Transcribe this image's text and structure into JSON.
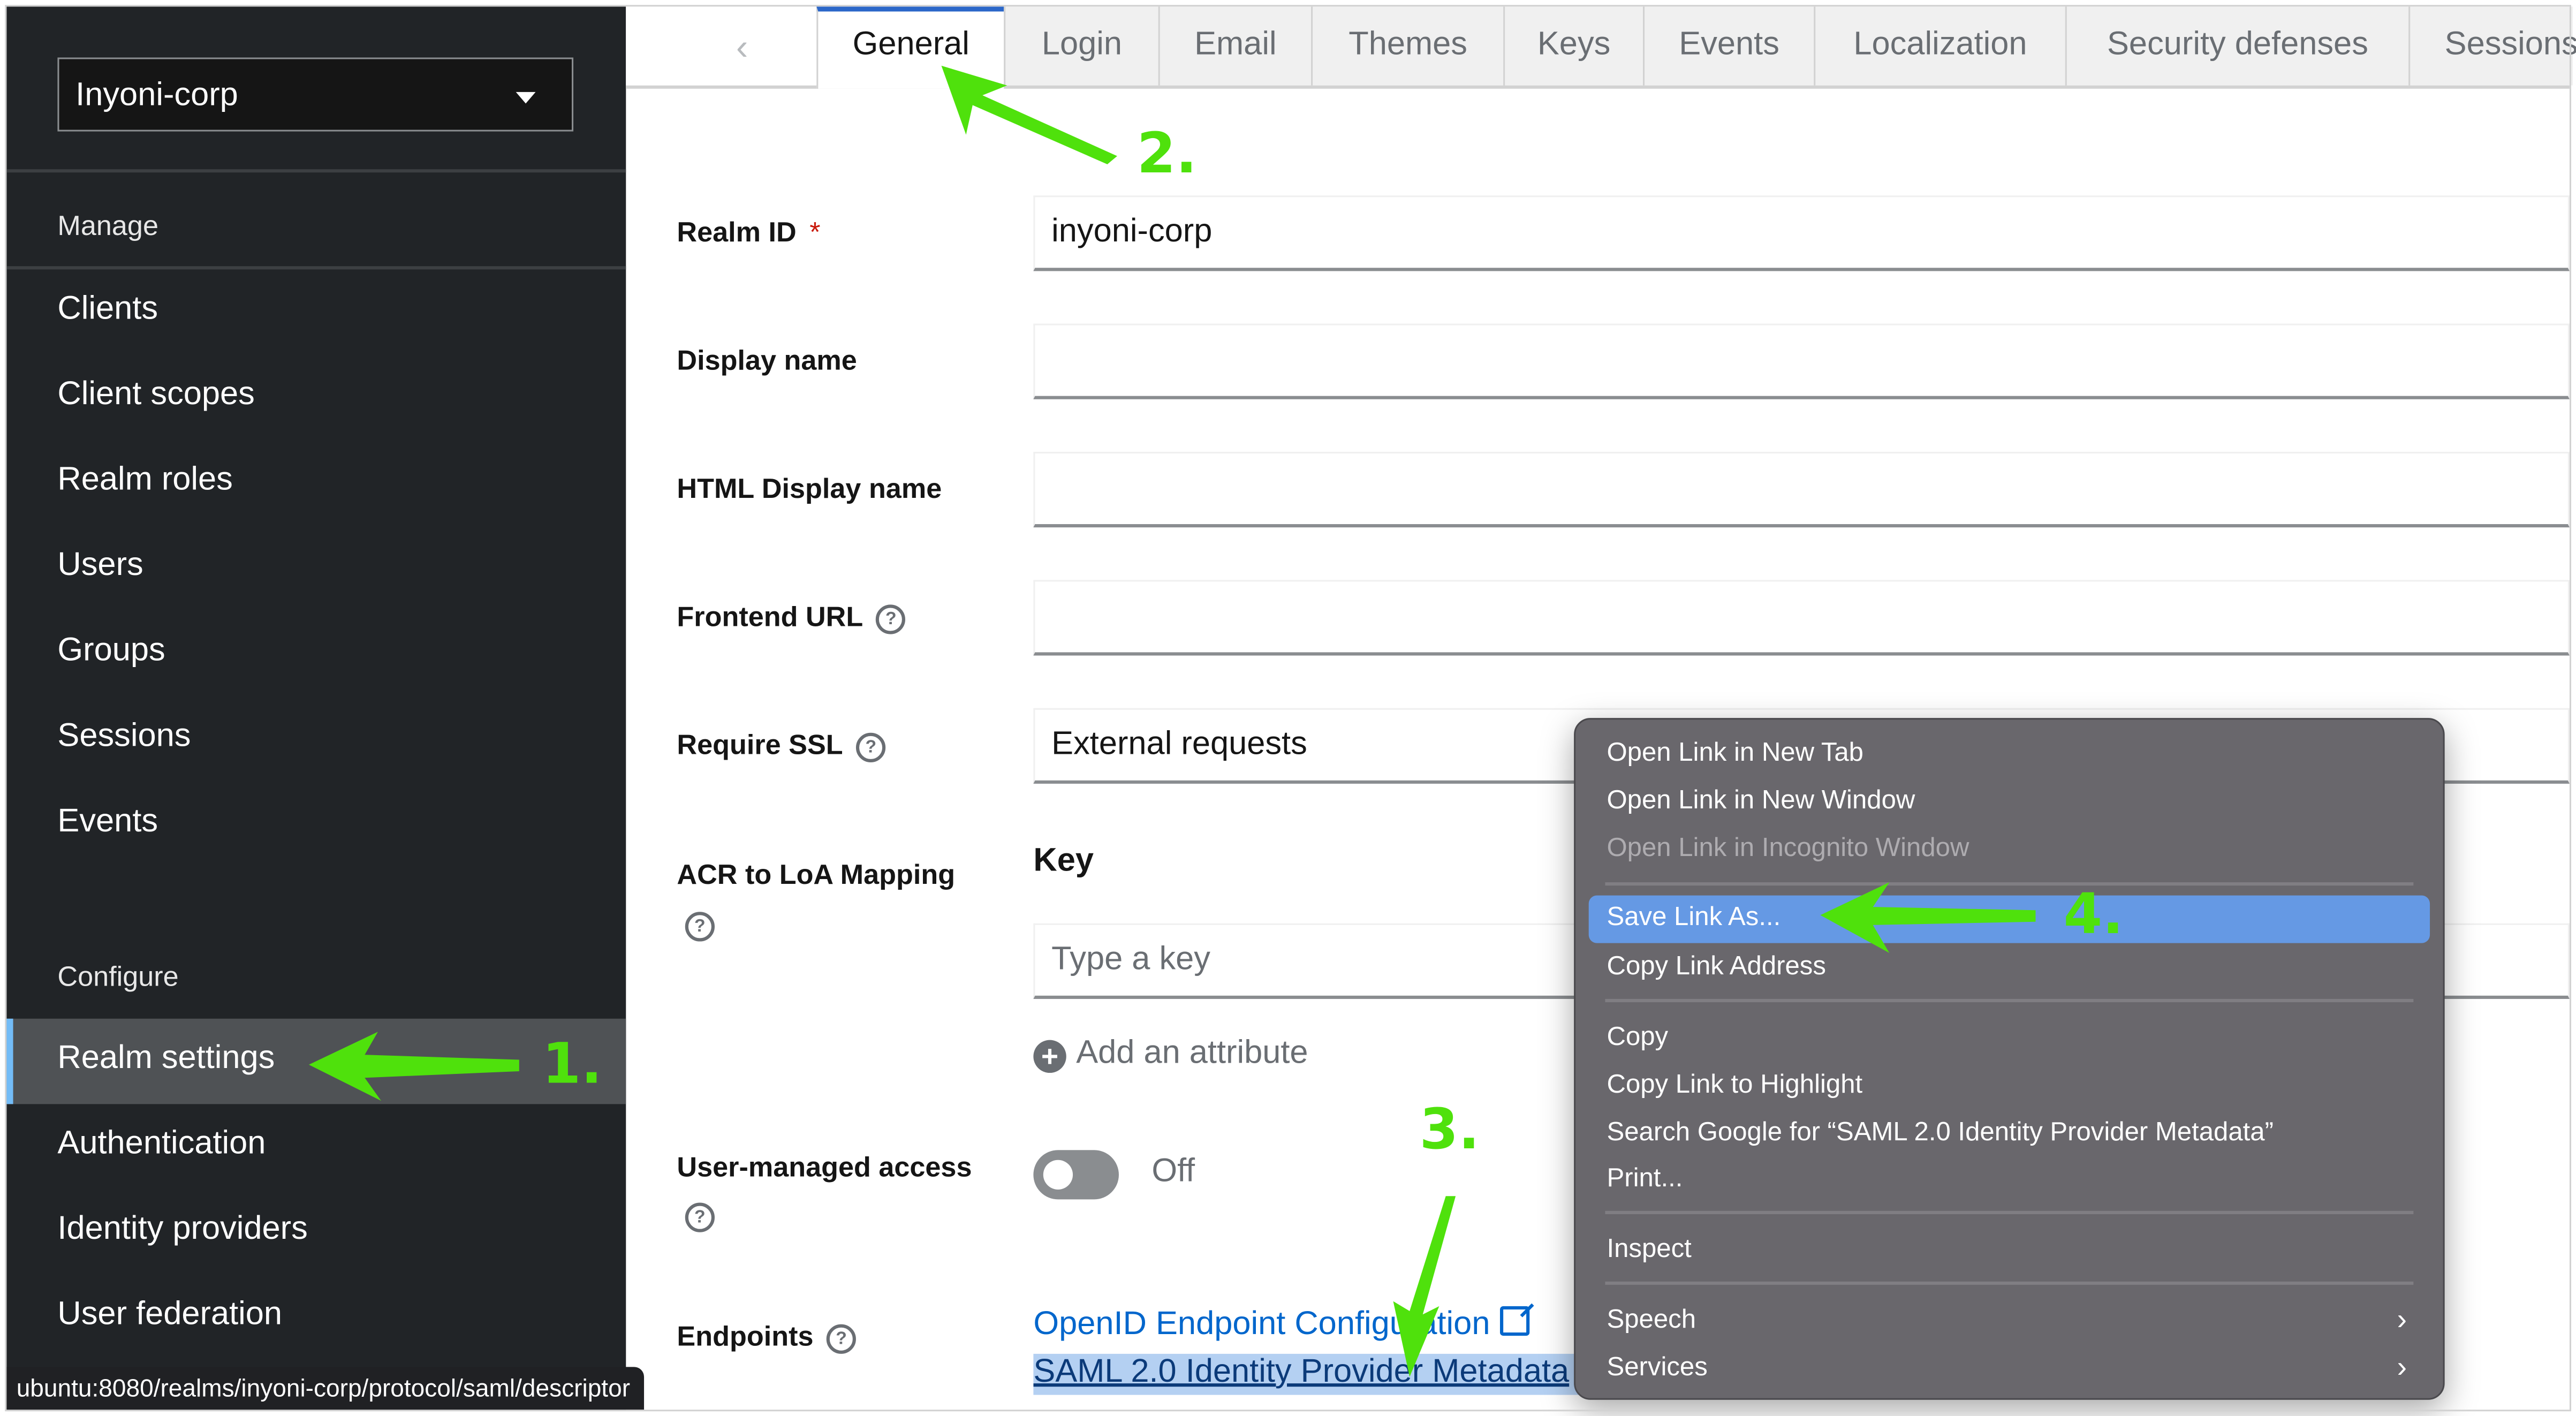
{
  "sidebar": {
    "realm_selector": {
      "value": "Inyoni-corp"
    },
    "sections": {
      "manage": "Manage",
      "configure": "Configure"
    },
    "manage_items": [
      {
        "label": "Clients"
      },
      {
        "label": "Client scopes"
      },
      {
        "label": "Realm roles"
      },
      {
        "label": "Users"
      },
      {
        "label": "Groups"
      },
      {
        "label": "Sessions"
      },
      {
        "label": "Events"
      }
    ],
    "configure_items": [
      {
        "label": "Realm settings",
        "active": true
      },
      {
        "label": "Authentication"
      },
      {
        "label": "Identity providers"
      },
      {
        "label": "User federation"
      }
    ]
  },
  "tabs": {
    "scroll_left_icon": "chevron-left-icon",
    "items": [
      {
        "label": "General",
        "active": true
      },
      {
        "label": "Login"
      },
      {
        "label": "Email"
      },
      {
        "label": "Themes"
      },
      {
        "label": "Keys"
      },
      {
        "label": "Events"
      },
      {
        "label": "Localization"
      },
      {
        "label": "Security defenses"
      },
      {
        "label": "Sessions"
      }
    ]
  },
  "form": {
    "realm_id": {
      "label": "Realm ID",
      "required_marker": "*",
      "value": "inyoni-corp"
    },
    "display_name": {
      "label": "Display name",
      "value": ""
    },
    "html_display_name": {
      "label": "HTML Display name",
      "value": ""
    },
    "frontend_url": {
      "label": "Frontend URL",
      "value": ""
    },
    "require_ssl": {
      "label": "Require SSL",
      "value": "External requests"
    },
    "acr_mapping": {
      "label": "ACR to LoA Mapping",
      "key_header": "Key",
      "key_placeholder": "Type a key",
      "add_attribute": "Add an attribute"
    },
    "user_managed_access": {
      "label": "User-managed access",
      "state": "Off",
      "enabled": false
    },
    "endpoints": {
      "label": "Endpoints",
      "openid": "OpenID Endpoint Configuration",
      "saml": "SAML 2.0 Identity Provider Metadata"
    },
    "help_glyph": "?"
  },
  "status_bar": {
    "url": "ubuntu:8080/realms/inyoni-corp/protocol/saml/descriptor"
  },
  "context_menu": {
    "items": [
      {
        "label": "Open Link in New Tab"
      },
      {
        "label": "Open Link in New Window"
      },
      {
        "label": "Open Link in Incognito Window",
        "disabled": true
      },
      {
        "label": "Save Link As...",
        "highlighted": true
      },
      {
        "label": "Copy Link Address"
      },
      {
        "label": "Copy"
      },
      {
        "label": "Copy Link to Highlight"
      },
      {
        "label": "Search Google for “SAML 2.0 Identity Provider Metadata”"
      },
      {
        "label": "Print..."
      },
      {
        "label": "Inspect"
      },
      {
        "label": "Speech",
        "submenu": true
      },
      {
        "label": "Services",
        "submenu": true
      }
    ],
    "submenu_glyph": "›"
  },
  "annotations": {
    "color": "#4fe10c",
    "steps": [
      "1.",
      "2.",
      "3.",
      "4."
    ]
  },
  "colors": {
    "sidebar_bg": "#212427",
    "sidebar_active_bg": "#4f5255",
    "active_indicator": "#73bcf7",
    "tab_active_border": "#2b67c9",
    "link": "#0066cc",
    "menu_bg": "#69676c",
    "menu_highlight": "#6599e4",
    "required": "#c9190b"
  }
}
